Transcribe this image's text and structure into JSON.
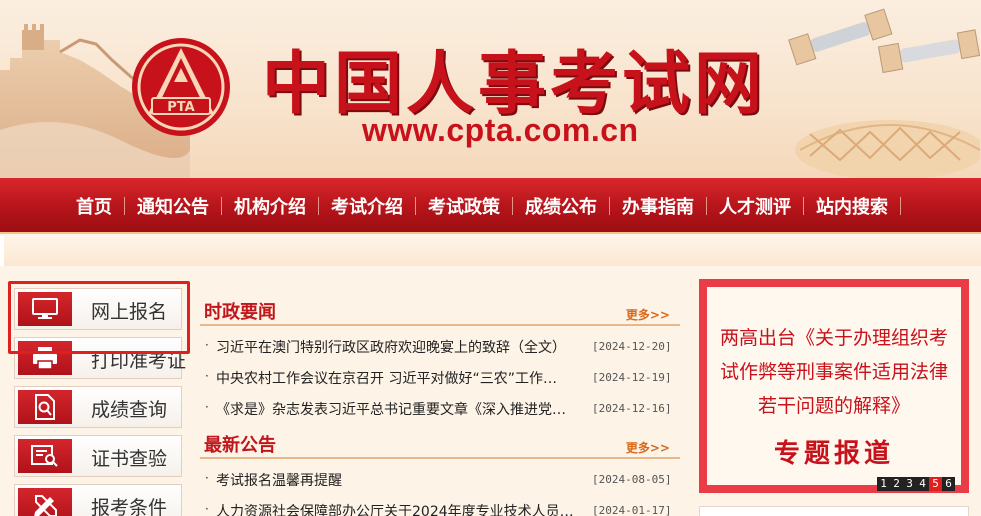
{
  "header": {
    "site_title": "中国人事考试网",
    "site_url": "www.cpta.com.cn",
    "logo_text": "PTA"
  },
  "nav": {
    "items": [
      "首页",
      "通知公告",
      "机构介绍",
      "考试介绍",
      "考试政策",
      "成绩公布",
      "办事指南",
      "人才测评",
      "站内搜索"
    ]
  },
  "sidebar": {
    "items": [
      {
        "label": "网上报名",
        "icon": "monitor-icon"
      },
      {
        "label": "打印准考证",
        "icon": "printer-icon"
      },
      {
        "label": "成绩查询",
        "icon": "search-document-icon"
      },
      {
        "label": "证书查验",
        "icon": "certificate-search-icon"
      },
      {
        "label": "报考条件",
        "icon": "pencil-ruler-icon"
      }
    ]
  },
  "news": {
    "section1": {
      "title": "时政要闻",
      "more": "更多>>",
      "items": [
        {
          "text": "习近平在澳门特别行政区政府欢迎晚宴上的致辞（全文）",
          "date": "[2024-12-20]"
        },
        {
          "text": "中央农村工作会议在京召开 习近平对做好“三农”工作…",
          "date": "[2024-12-19]"
        },
        {
          "text": "《求是》杂志发表习近平总书记重要文章《深入推进党的…",
          "date": "[2024-12-16]"
        }
      ]
    },
    "section2": {
      "title": "最新公告",
      "more": "更多>>",
      "items": [
        {
          "text": "考试报名温馨再提醒",
          "date": "[2024-08-05]"
        },
        {
          "text": "人力资源社会保障部办公厅关于2024年度专业技术人员职…",
          "date": "[2024-01-17]"
        }
      ]
    }
  },
  "promo": {
    "text": "两高出台《关于办理组织考试作弊等刑事案件适用法律若干问题的解释》",
    "special": "专题报道",
    "pages": [
      "1",
      "2",
      "3",
      "4",
      "5",
      "6"
    ],
    "active_page": "5"
  },
  "colors": {
    "brand_red": "#c8121b",
    "nav_red": "#b5141a",
    "accent_orange": "#d96a1b"
  }
}
